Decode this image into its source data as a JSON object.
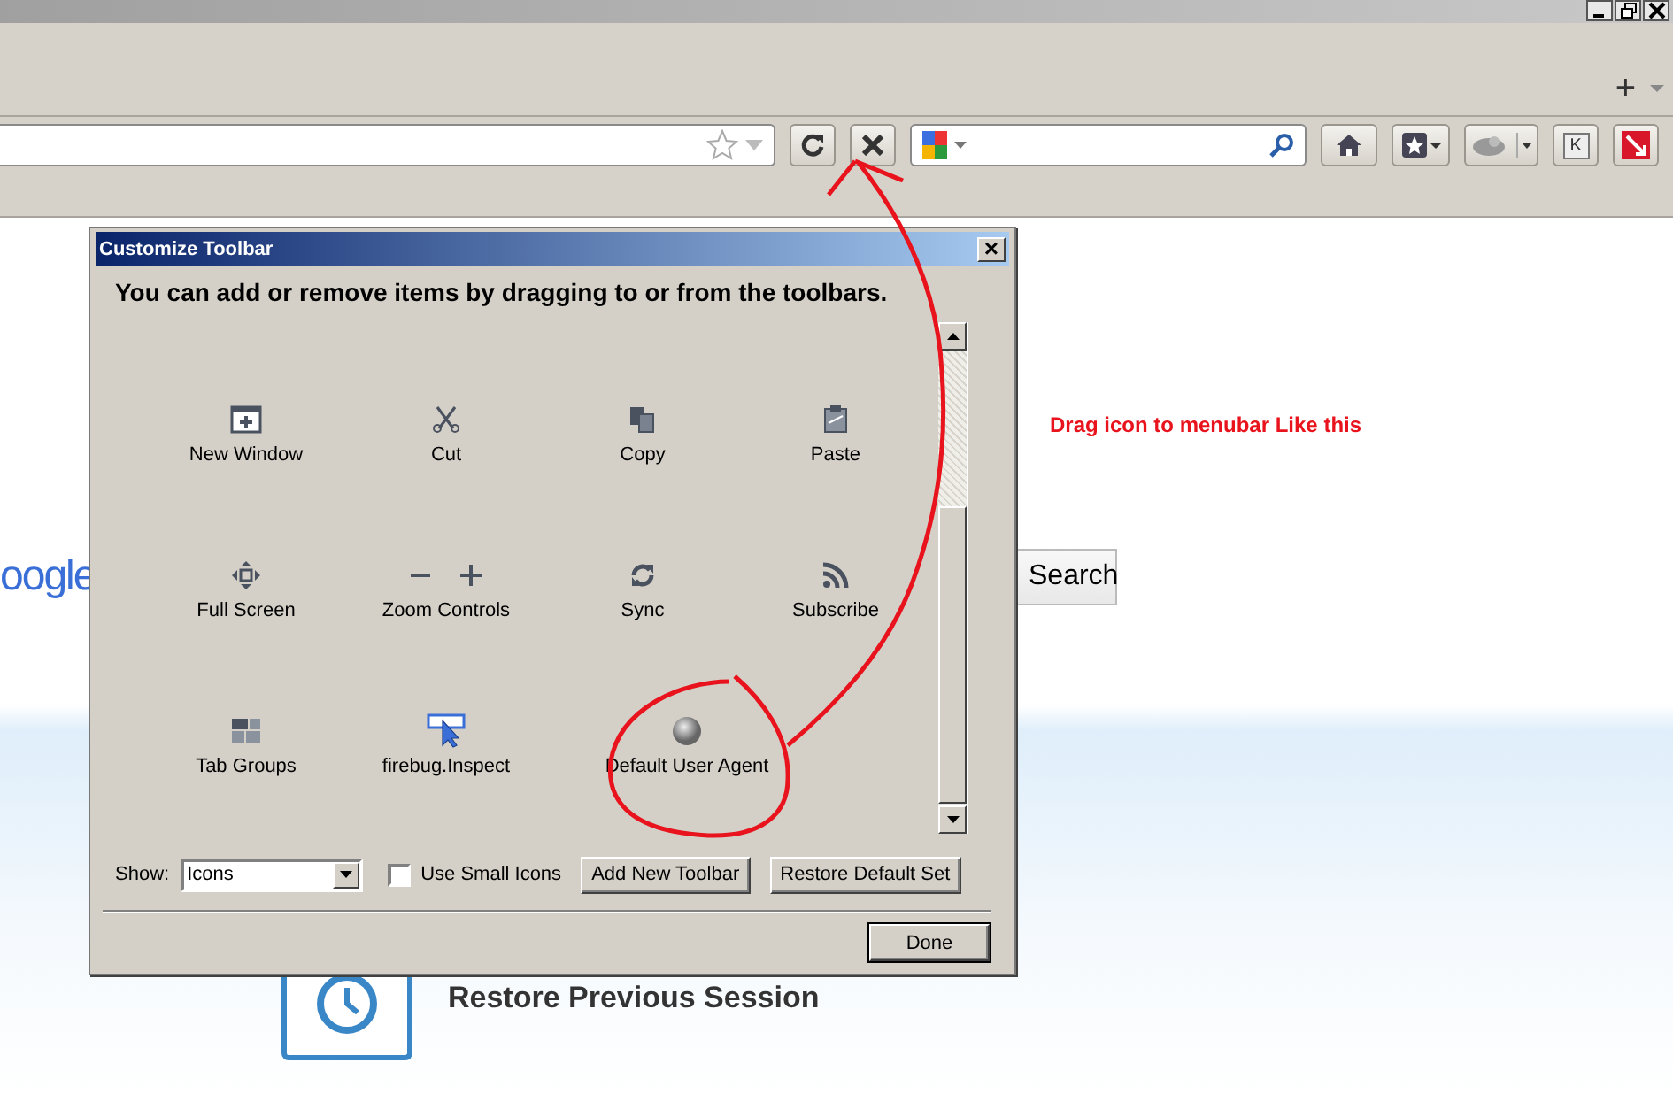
{
  "tab_strip": {
    "new_tab": "+"
  },
  "nav_bar": {
    "addon_letter": "K"
  },
  "page": {
    "logo_text": "oogle",
    "search_button": "Search",
    "restore_session": "Restore Previous Session"
  },
  "annotation": {
    "note": "Drag icon to menubar Like this"
  },
  "dialog": {
    "title": "Customize Toolbar",
    "close": "×",
    "instructions": "You can add or remove items by dragging to or from the toolbars.",
    "items": [
      {
        "kind": "new-window",
        "label": "New Window"
      },
      {
        "kind": "cut",
        "label": "Cut"
      },
      {
        "kind": "copy",
        "label": "Copy"
      },
      {
        "kind": "paste",
        "label": "Paste"
      },
      {
        "kind": "full-screen",
        "label": "Full Screen"
      },
      {
        "kind": "zoom",
        "label": "Zoom Controls"
      },
      {
        "kind": "sync",
        "label": "Sync"
      },
      {
        "kind": "subscribe",
        "label": "Subscribe"
      },
      {
        "kind": "tab-groups",
        "label": "Tab Groups"
      },
      {
        "kind": "inspect",
        "label": "firebug.Inspect"
      },
      {
        "kind": "user-agent",
        "label": "Default User Agent"
      }
    ],
    "show": {
      "label": "Show:",
      "value": "Icons"
    },
    "small_icons": {
      "label": "Use Small Icons",
      "checked": false
    },
    "buttons": [
      "Add New Toolbar",
      "Restore Default Set"
    ],
    "done": "Done"
  }
}
